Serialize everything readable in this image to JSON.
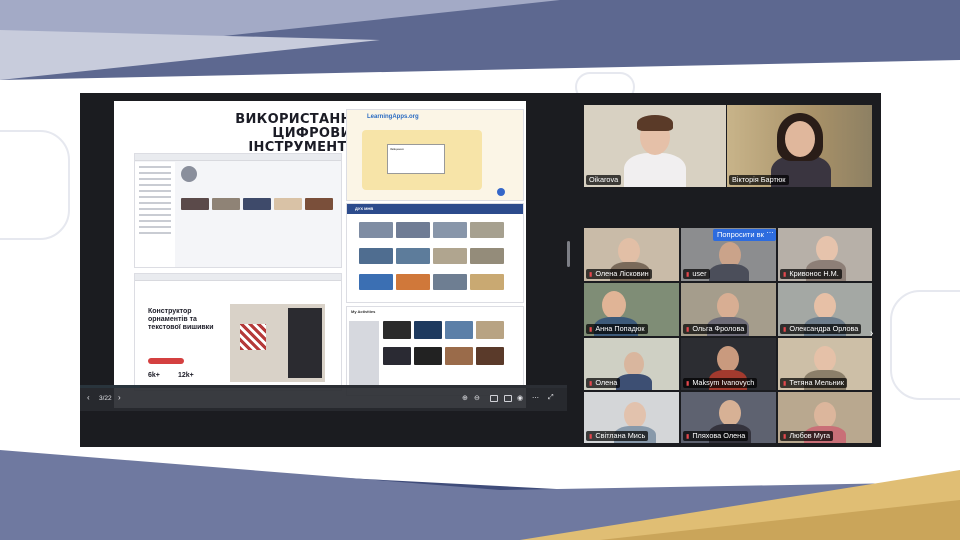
{
  "slide": {
    "title_line1": "ВИКОРИСТАННЯ ЦИФРОВИХ",
    "title_line2": "ІНСТРУМЕНТІВ",
    "learningapps_title": "LearningApps.org",
    "learningapps_dialog": "Зміщення",
    "banner_site_title": "ДУХ МНВ",
    "constructor_title_line1": "Конструктор",
    "constructor_title_line2": "орнаментів та",
    "constructor_title_line3": "текстової вишивки",
    "stat1": "6k+",
    "stat2": "12k+",
    "my_activities": "My Activities"
  },
  "viewer": {
    "page_counter": "3/22"
  },
  "participants": {
    "featured": [
      {
        "name": "Oikarova",
        "active": false
      },
      {
        "name": "Вікторія Бартюк",
        "active": true
      }
    ],
    "grid": [
      {
        "name": "Олена Лісковин",
        "mic_off": true
      },
      {
        "name": "user",
        "mic_off": true
      },
      {
        "name": "Кривонос Н.М.",
        "mic_off": true
      },
      {
        "name": "Анна Попадюк",
        "mic_off": true
      },
      {
        "name": "Ольга Фролова",
        "mic_off": true
      },
      {
        "name": "Олександра Орлова",
        "mic_off": true
      },
      {
        "name": "Олена",
        "mic_off": true
      },
      {
        "name": "Maksym Ivanovych",
        "mic_off": true
      },
      {
        "name": "Тетяна Мельник",
        "mic_off": true
      },
      {
        "name": "Світлана Мись",
        "mic_off": true
      },
      {
        "name": "Пляхова Олена",
        "mic_off": true
      },
      {
        "name": "Любов Муга",
        "mic_off": true
      }
    ],
    "request_button_label": "Попросити вкл",
    "more_button_label": "⋯"
  },
  "colors": {
    "accent": "#3ecf8e",
    "button": "#2d6cdf",
    "mic_off": "#e5484d",
    "conference_bg": "#1b1c20"
  }
}
